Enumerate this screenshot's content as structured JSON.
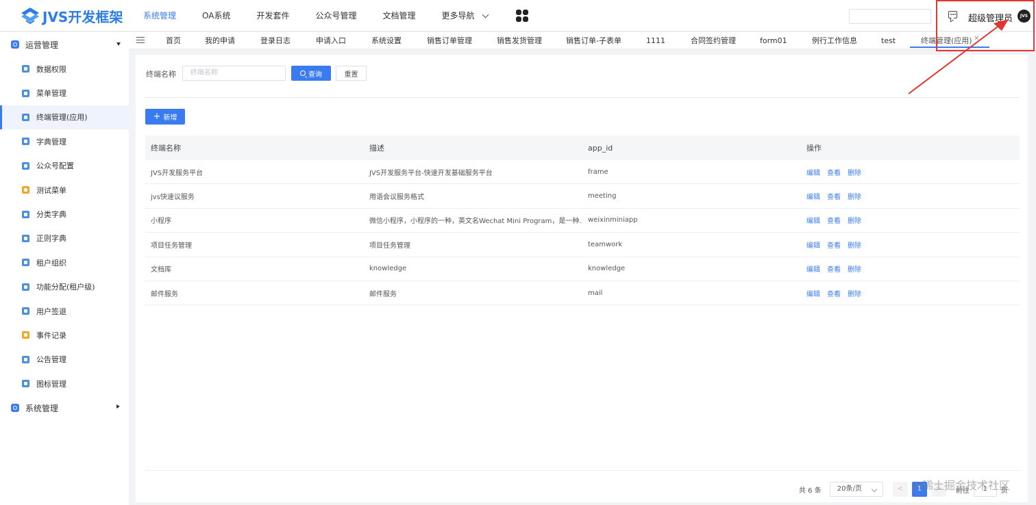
{
  "header": {
    "logo_text": "JVS开发框架",
    "nav": [
      {
        "label": "系统管理",
        "active": true
      },
      {
        "label": "OA系统",
        "active": false
      },
      {
        "label": "开发套件",
        "active": false
      },
      {
        "label": "公众号管理",
        "active": false
      },
      {
        "label": "文档管理",
        "active": false
      },
      {
        "label": "更多导航",
        "active": false
      }
    ],
    "search_value": "",
    "username": "超级管理员",
    "avatar_text": "JVS"
  },
  "sidebar": {
    "group_ops": "运营管理",
    "items": [
      {
        "label": "数据权限",
        "color": "#4a90e2"
      },
      {
        "label": "菜单管理",
        "color": "#4a90e2"
      },
      {
        "label": "终端管理(应用)",
        "color": "#4a90e2",
        "active": true
      },
      {
        "label": "字典管理",
        "color": "#4a90e2"
      },
      {
        "label": "公众号配置",
        "color": "#4a90e2"
      },
      {
        "label": "测试菜单",
        "color": "#f5a623"
      },
      {
        "label": "分类字典",
        "color": "#4a90e2"
      },
      {
        "label": "正则字典",
        "color": "#4a90e2"
      },
      {
        "label": "租户组织",
        "color": "#4a90e2"
      },
      {
        "label": "功能分配(租户级)",
        "color": "#4a90e2"
      },
      {
        "label": "用户签退",
        "color": "#4a90e2"
      },
      {
        "label": "事件记录",
        "color": "#f5a623"
      },
      {
        "label": "公告管理",
        "color": "#4a90e2"
      },
      {
        "label": "图标管理",
        "color": "#4a90e2"
      }
    ],
    "group_sys": "系统管理"
  },
  "tabs": [
    "首页",
    "我的申请",
    "登录日志",
    "申请入口",
    "系统设置",
    "销售订单管理",
    "销售发货管理",
    "销售订单-子表单",
    "1111",
    "合同签约管理",
    "form01",
    "例行工作信息",
    "test",
    "终端管理(应用)"
  ],
  "filter": {
    "label": "终端名称",
    "placeholder": "终端名称",
    "query_label": "查询",
    "reset_label": "重置"
  },
  "add_label": "新增",
  "table": {
    "columns": [
      "终端名称",
      "描述",
      "app_id",
      "操作"
    ],
    "rows": [
      {
        "name": "JVS开发服务平台",
        "desc": "JVS开发服务平台-快速开发基础服务平台",
        "app_id": "frame"
      },
      {
        "name": "jvs快速议服务",
        "desc": "用语会议服务格式",
        "app_id": "meeting"
      },
      {
        "name": "小程序",
        "desc": "微信小程序，小程序的一种，英文名Wechat Mini Program，是一种...",
        "app_id": "weixinminiapp"
      },
      {
        "name": "项目任务管理",
        "desc": "项目任务管理",
        "app_id": "teamwork"
      },
      {
        "name": "文档库",
        "desc": "knowledge",
        "app_id": "knowledge"
      },
      {
        "name": "邮件服务",
        "desc": "邮件服务",
        "app_id": "mail"
      }
    ],
    "actions": [
      "编辑",
      "查看",
      "删除"
    ]
  },
  "pager": {
    "total": "共 6 条",
    "size": "20条/页",
    "prev": "<",
    "current": "1",
    "next": ">",
    "goto": "前往",
    "goto_value": "1",
    "page_suffix": "页"
  },
  "watermark": "@稀土掘金技术社区"
}
